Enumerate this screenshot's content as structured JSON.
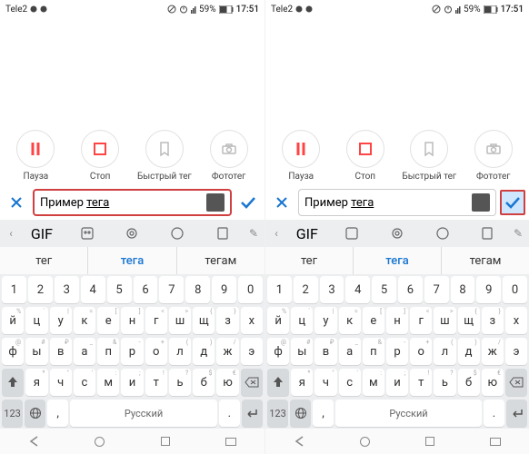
{
  "status": {
    "carrier": "Tele2",
    "battery_pct": "59%",
    "time": "17:51"
  },
  "actions": {
    "pause": "Пауза",
    "stop": "Стоп",
    "quicktag": "Быстрый тег",
    "phototag": "Фототег"
  },
  "tag_input": {
    "prefix": "Пример ",
    "underlined": "тега"
  },
  "keyboard": {
    "suggestions": [
      "тег",
      "тега",
      "тегам"
    ],
    "row_num": [
      "1",
      "2",
      "3",
      "4",
      "5",
      "6",
      "7",
      "8",
      "9",
      "0"
    ],
    "row1": [
      "й",
      "ц",
      "у",
      "к",
      "е",
      "н",
      "г",
      "ш",
      "щ",
      "з",
      "х"
    ],
    "row1_sub": [
      "%",
      "`",
      "|",
      "=",
      "[",
      "]",
      "<",
      ">",
      "{",
      "}",
      ""
    ],
    "row2": [
      "ф",
      "ы",
      "в",
      "а",
      "п",
      "р",
      "о",
      "л",
      "д",
      "ж",
      "э"
    ],
    "row2_sub": [
      "@",
      "#",
      "₽",
      "_",
      "&",
      "-",
      "+",
      "(",
      ")",
      "/",
      ""
    ],
    "row3": [
      "я",
      "ч",
      "с",
      "м",
      "и",
      "т",
      "ь",
      "б",
      "ю"
    ],
    "row3_sub": [
      "*",
      "\"",
      "'",
      ":",
      ";",
      "!",
      "?",
      "$",
      "€"
    ],
    "key123": "123",
    "space": "Русский"
  }
}
